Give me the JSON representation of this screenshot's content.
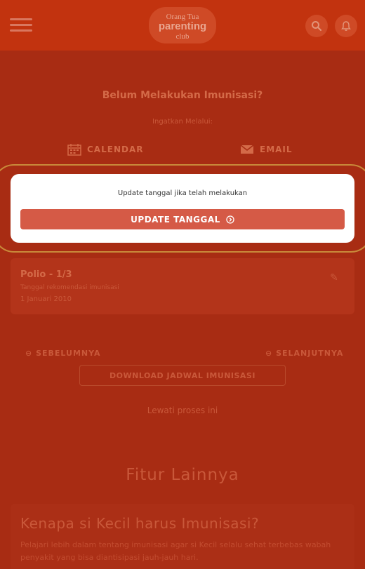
{
  "header": {
    "logo": {
      "top": "Orang Tua",
      "middle": "parenting",
      "bottom": "club"
    },
    "icons": {
      "menu": "hamburger-icon",
      "search": "search-icon",
      "notifications": "bell-icon"
    }
  },
  "reminder": {
    "question": "Belum Melakukan Imunisasi?",
    "remind_label": "Ingatkan Melalui:",
    "calendar_label": "CALENDAR",
    "email_label": "EMAIL"
  },
  "modal": {
    "text": "Update tanggal jika telah melakukan",
    "button_label": "UPDATE TANGGAL"
  },
  "vaccine_card": {
    "title": "Polio - 1/3",
    "subtitle": "Tanggal rekomendasi imunisasi",
    "date": "1 Januari 2010"
  },
  "navigation": {
    "prev_label": "SEBELUMNYA",
    "next_label": "SELANJUTNYA",
    "download_label": "DOWNLOAD JADWAL IMUNISASI",
    "skip_label": "Lewati proses ini"
  },
  "features": {
    "section_title": "Fitur Lainnya",
    "card_title": "Kenapa si Kecil harus Imunisasi?",
    "card_desc": "Pelajari lebih dalam tentang imunisasi agar si Kecil selalu sehat terbebas wabah penyakit yang bisa diantisipasi jauh-jauh hari."
  },
  "colors": {
    "header": "#c2330f",
    "overlay_background": "#a82c13",
    "modal_background": "#ffffff",
    "primary_button": "#d55a46"
  }
}
